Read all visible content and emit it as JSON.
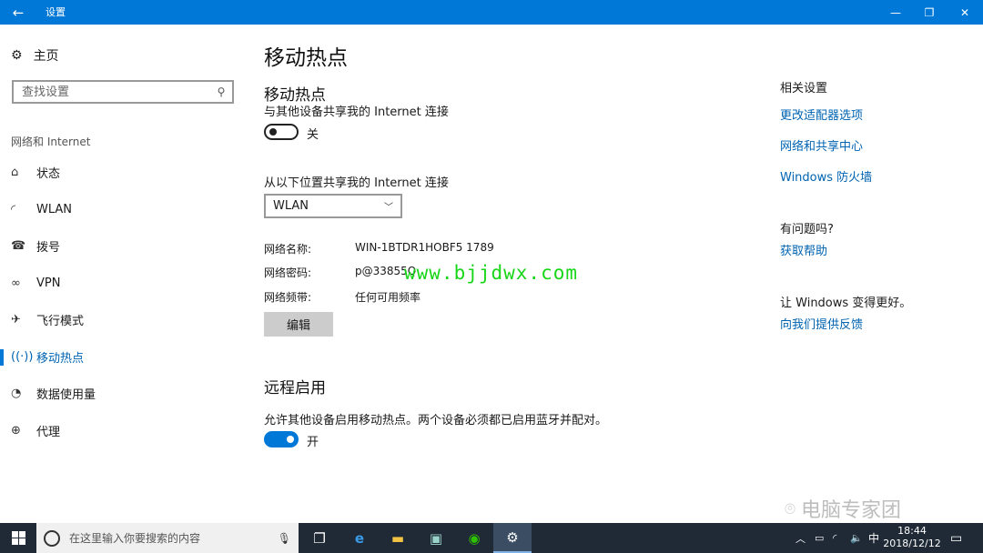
{
  "window": {
    "title": "设置"
  },
  "nav": {
    "home": "主页",
    "search_placeholder": "查找设置",
    "section": "网络和 Internet",
    "items": [
      {
        "label": "状态",
        "icon": "home-status-icon"
      },
      {
        "label": "WLAN",
        "icon": "wifi-icon"
      },
      {
        "label": "拨号",
        "icon": "dialup-icon"
      },
      {
        "label": "VPN",
        "icon": "vpn-icon"
      },
      {
        "label": "飞行模式",
        "icon": "airplane-icon"
      },
      {
        "label": "移动热点",
        "icon": "hotspot-icon",
        "active": true
      },
      {
        "label": "数据使用量",
        "icon": "data-usage-icon"
      },
      {
        "label": "代理",
        "icon": "globe-icon"
      }
    ]
  },
  "main": {
    "page_title": "移动热点",
    "hotspot": {
      "heading": "移动热点",
      "desc": "与其他设备共享我的 Internet 连接",
      "toggle_label": "关",
      "toggle_on": false
    },
    "share_from": {
      "label": "从以下位置共享我的 Internet 连接",
      "selected": "WLAN"
    },
    "network": {
      "name_label": "网络名称:",
      "name_value": "WIN-1BTDR1HOBF5 1789",
      "password_label": "网络密码:",
      "password_value": "p@33855Q",
      "band_label": "网络频带:",
      "band_value": "任何可用频率"
    },
    "edit_label": "编辑",
    "watermark": "www.bjjdwx.com",
    "remote": {
      "heading": "远程启用",
      "desc": "允许其他设备启用移动热点。两个设备必须都已启用蓝牙并配对。",
      "toggle_label": "开",
      "toggle_on": true
    }
  },
  "related": {
    "heading": "相关设置",
    "links": [
      "更改适配器选项",
      "网络和共享中心",
      "Windows 防火墙"
    ],
    "question": "有问题吗?",
    "help": "获取帮助",
    "improve": "让 Windows 变得更好。",
    "feedback": "向我们提供反馈"
  },
  "brand": {
    "text": "电脑专家团"
  },
  "taskbar": {
    "search_placeholder": "在这里输入你要搜索的内容",
    "tray_lang": "中",
    "time": "18:44",
    "date": "2018/12/12"
  },
  "colors": {
    "accent": "#0078d7",
    "link": "#0063b1",
    "taskbar": "#1f2a36",
    "watermark": "#17d617"
  }
}
